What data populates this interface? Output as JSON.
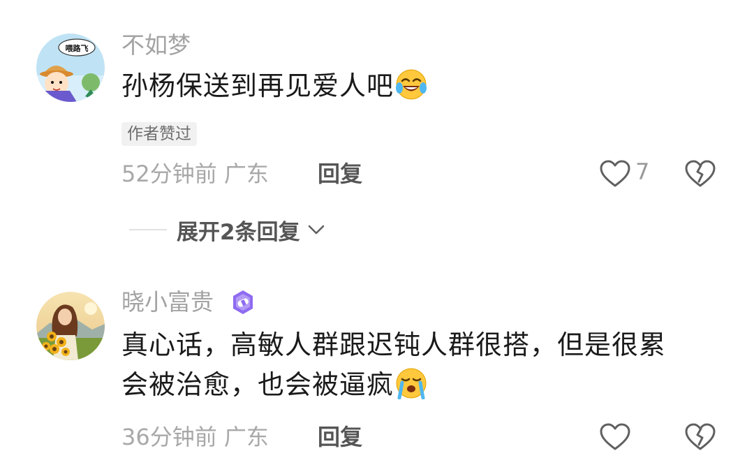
{
  "comments": [
    {
      "username": "不如梦",
      "avatar_icon": "cartoon-avatar-icon",
      "avatar_text": "喂路飞",
      "text": "孙杨保送到再见爱人吧",
      "emoji": "crying-laughing-emoji",
      "author_liked_label": "作者赞过",
      "time_location": "52分钟前 广东",
      "reply_label": "回复",
      "like_count": "7",
      "expand_replies_label": "展开2条回复"
    },
    {
      "username": "晓小富贵",
      "avatar_icon": "sunflower-girl-avatar-icon",
      "badge_icon": "purple-badge-icon",
      "text_line1": "真心话，高敏人群跟迟钝人群很搭，但是很累",
      "text_line2": "会被治愈，也会被逼疯",
      "emoji": "sobbing-emoji",
      "time_location": "36分钟前 广东",
      "reply_label": "回复",
      "like_count": ""
    }
  ],
  "colors": {
    "username": "#a3a3a3",
    "meta": "#a8a8a8",
    "badge": "#8e6bf0",
    "emoji_yellow": "#ffc83d"
  }
}
